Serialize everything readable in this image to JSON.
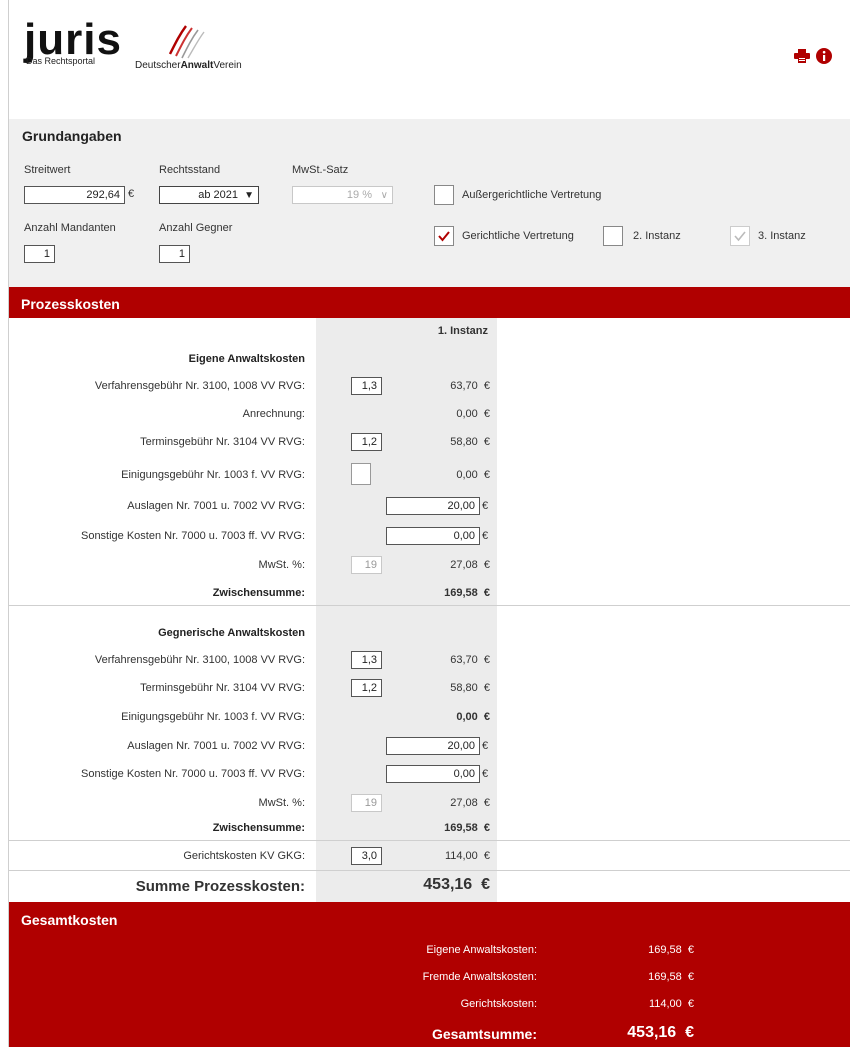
{
  "header": {
    "juris_logo": "juris",
    "juris_sub": "Das Rechtsportal",
    "dav_pre": "Deutscher",
    "dav_bold": "Anwalt",
    "dav_post": "Verein",
    "icons": [
      "print-icon",
      "info-icon"
    ],
    "accent": "#b00000"
  },
  "grund": {
    "title": "Grundangaben",
    "streitwert_label": "Streitwert",
    "streitwert_value": "292,64",
    "streitwert_unit": "€",
    "rechtsstand_label": "Rechtsstand",
    "rechtsstand_value": "ab 2021",
    "mwst_label": "MwSt.-Satz",
    "mwst_value": "19 %",
    "aussergerichtlich_label": "Außergerichtliche Vertretung",
    "aussergerichtlich_checked": false,
    "mandanten_label": "Anzahl Mandanten",
    "mandanten_value": "1",
    "gegner_label": "Anzahl Gegner",
    "gegner_value": "1",
    "gerichtlich_label": "Gerichtliche Vertretung",
    "gerichtlich_checked": true,
    "instanz2_label": "2. Instanz",
    "instanz2_checked": false,
    "instanz3_label": "3. Instanz",
    "instanz3_checked": true
  },
  "prozess": {
    "title": "Prozesskosten",
    "col_header": "1. Instanz",
    "eigene": {
      "heading": "Eigene Anwaltskosten",
      "rows": [
        {
          "label": "Verfahrensgebühr Nr. 3100, 1008 VV RVG:",
          "factor": "1,3",
          "value": "63,70"
        },
        {
          "label": "Anrechnung:",
          "value": "0,00"
        },
        {
          "label": "Terminsgebühr Nr. 3104 VV RVG:",
          "factor": "1,2",
          "value": "58,80"
        },
        {
          "label": "Einigungsgebühr Nr. 1003 f. VV RVG:",
          "factor": "",
          "value": "0,00"
        },
        {
          "label": "Auslagen Nr. 7001 u. 7002 VV RVG:",
          "input": "20,00"
        },
        {
          "label": "Sonstige Kosten Nr. 7000 u. 7003 ff. VV RVG:",
          "input": "0,00"
        },
        {
          "label": "MwSt. %:",
          "factor": "19",
          "value": "27,08"
        }
      ],
      "subtotal_label": "Zwischensumme:",
      "subtotal_value": "169,58"
    },
    "gegner": {
      "heading": "Gegnerische Anwaltskosten",
      "rows": [
        {
          "label": "Verfahrensgebühr Nr. 3100, 1008 VV RVG:",
          "factor": "1,3",
          "value": "63,70"
        },
        {
          "label": "Terminsgebühr Nr. 3104 VV RVG:",
          "factor": "1,2",
          "value": "58,80"
        },
        {
          "label": "Einigungsgebühr Nr. 1003 f. VV RVG:",
          "value": "0,00"
        },
        {
          "label": "Auslagen Nr. 7001 u. 7002 VV RVG:",
          "input": "20,00"
        },
        {
          "label": "Sonstige Kosten Nr. 7000 u. 7003 ff. VV RVG:",
          "input": "0,00"
        },
        {
          "label": "MwSt. %:",
          "factor": "19",
          "value": "27,08"
        }
      ],
      "subtotal_label": "Zwischensumme:",
      "subtotal_value": "169,58"
    },
    "gericht": {
      "label": "Gerichtskosten KV GKG:",
      "factor": "3,0",
      "value": "114,00"
    },
    "summe_label": "Summe Prozesskosten:",
    "summe_value": "453,16",
    "currency": "€"
  },
  "gesamt": {
    "title": "Gesamtkosten",
    "rows": [
      {
        "label": "Eigene Anwaltskosten:",
        "value": "169,58"
      },
      {
        "label": "Fremde Anwaltskosten:",
        "value": "169,58"
      },
      {
        "label": "Gerichtskosten:",
        "value": "114,00"
      }
    ],
    "total_label": "Gesamtsumme:",
    "total_value": "453,16",
    "currency": "€"
  }
}
